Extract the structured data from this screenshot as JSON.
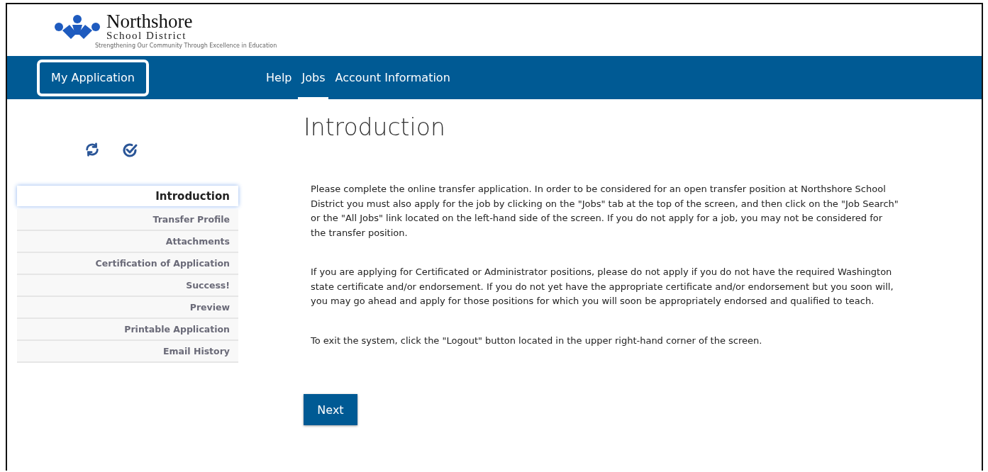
{
  "logo": {
    "name": "Northshore",
    "subtitle": "School District",
    "tagline": "Strengthening Our Community Through Excellence in Education"
  },
  "nav": {
    "brand": "My Application",
    "items": [
      {
        "label": "Help",
        "selected": false
      },
      {
        "label": "Jobs",
        "selected": true
      },
      {
        "label": "Account Information",
        "selected": false
      }
    ]
  },
  "sidebar": {
    "items": [
      {
        "label": "Introduction",
        "selected": true
      },
      {
        "label": "Transfer Profile",
        "selected": false
      },
      {
        "label": "Attachments",
        "selected": false
      },
      {
        "label": "Certification of Application",
        "selected": false
      },
      {
        "label": "Success!",
        "selected": false
      },
      {
        "label": "Preview",
        "selected": false
      },
      {
        "label": "Printable Application",
        "selected": false
      },
      {
        "label": "Email History",
        "selected": false
      }
    ]
  },
  "main": {
    "title": "Introduction",
    "paragraphs": [
      "Please complete the online transfer application. In order to be considered for an open transfer position at Northshore School District you must also apply for the job by clicking on the \"Jobs\" tab at the top of the screen, and then click on the \"Job Search\" or the \"All Jobs\" link located on the left-hand side of the screen. If you do not apply for a job, you may not be considered for the transfer position.",
      "If you are applying for Certificated or Administrator positions, please do not apply if you do not have the required Washington state certificate and/or endorsement. If you do not yet have the appropriate certificate and/or endorsement but you soon will, you may go ahead and apply for those positions for which you will soon be appropriately endorsed and qualified to teach.",
      "To exit the system, click the \"Logout\" button located in the upper right-hand corner of the screen."
    ],
    "button": "Next"
  }
}
